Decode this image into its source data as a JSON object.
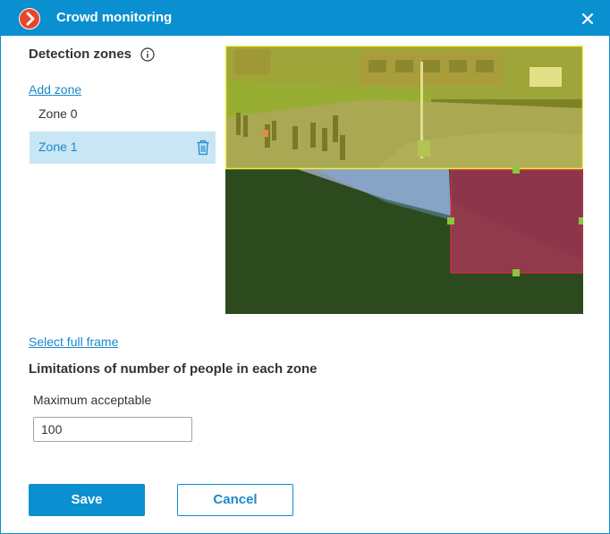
{
  "window": {
    "title": "Crowd monitoring",
    "accent_color": "#0a8fd1",
    "app_icon": "chevron-right-icon",
    "close_icon": "close-icon"
  },
  "zones_section": {
    "title": "Detection zones",
    "info_icon": "info-icon",
    "add_zone_label": "Add zone",
    "zones": [
      {
        "label": "Zone 0",
        "selected": false
      },
      {
        "label": "Zone 1",
        "selected": true,
        "action_icon": "trash-icon"
      }
    ]
  },
  "video": {
    "zone_overlay_colors": {
      "zone_0": "#f2ee3a",
      "zone_1": "#d4306a",
      "handles": "#8cc63f"
    }
  },
  "select_full_frame_label": "Select full frame",
  "limits": {
    "title": "Limitations of number of people in each zone",
    "max_label": "Maximum acceptable",
    "max_value": "100"
  },
  "buttons": {
    "save": "Save",
    "cancel": "Cancel"
  }
}
